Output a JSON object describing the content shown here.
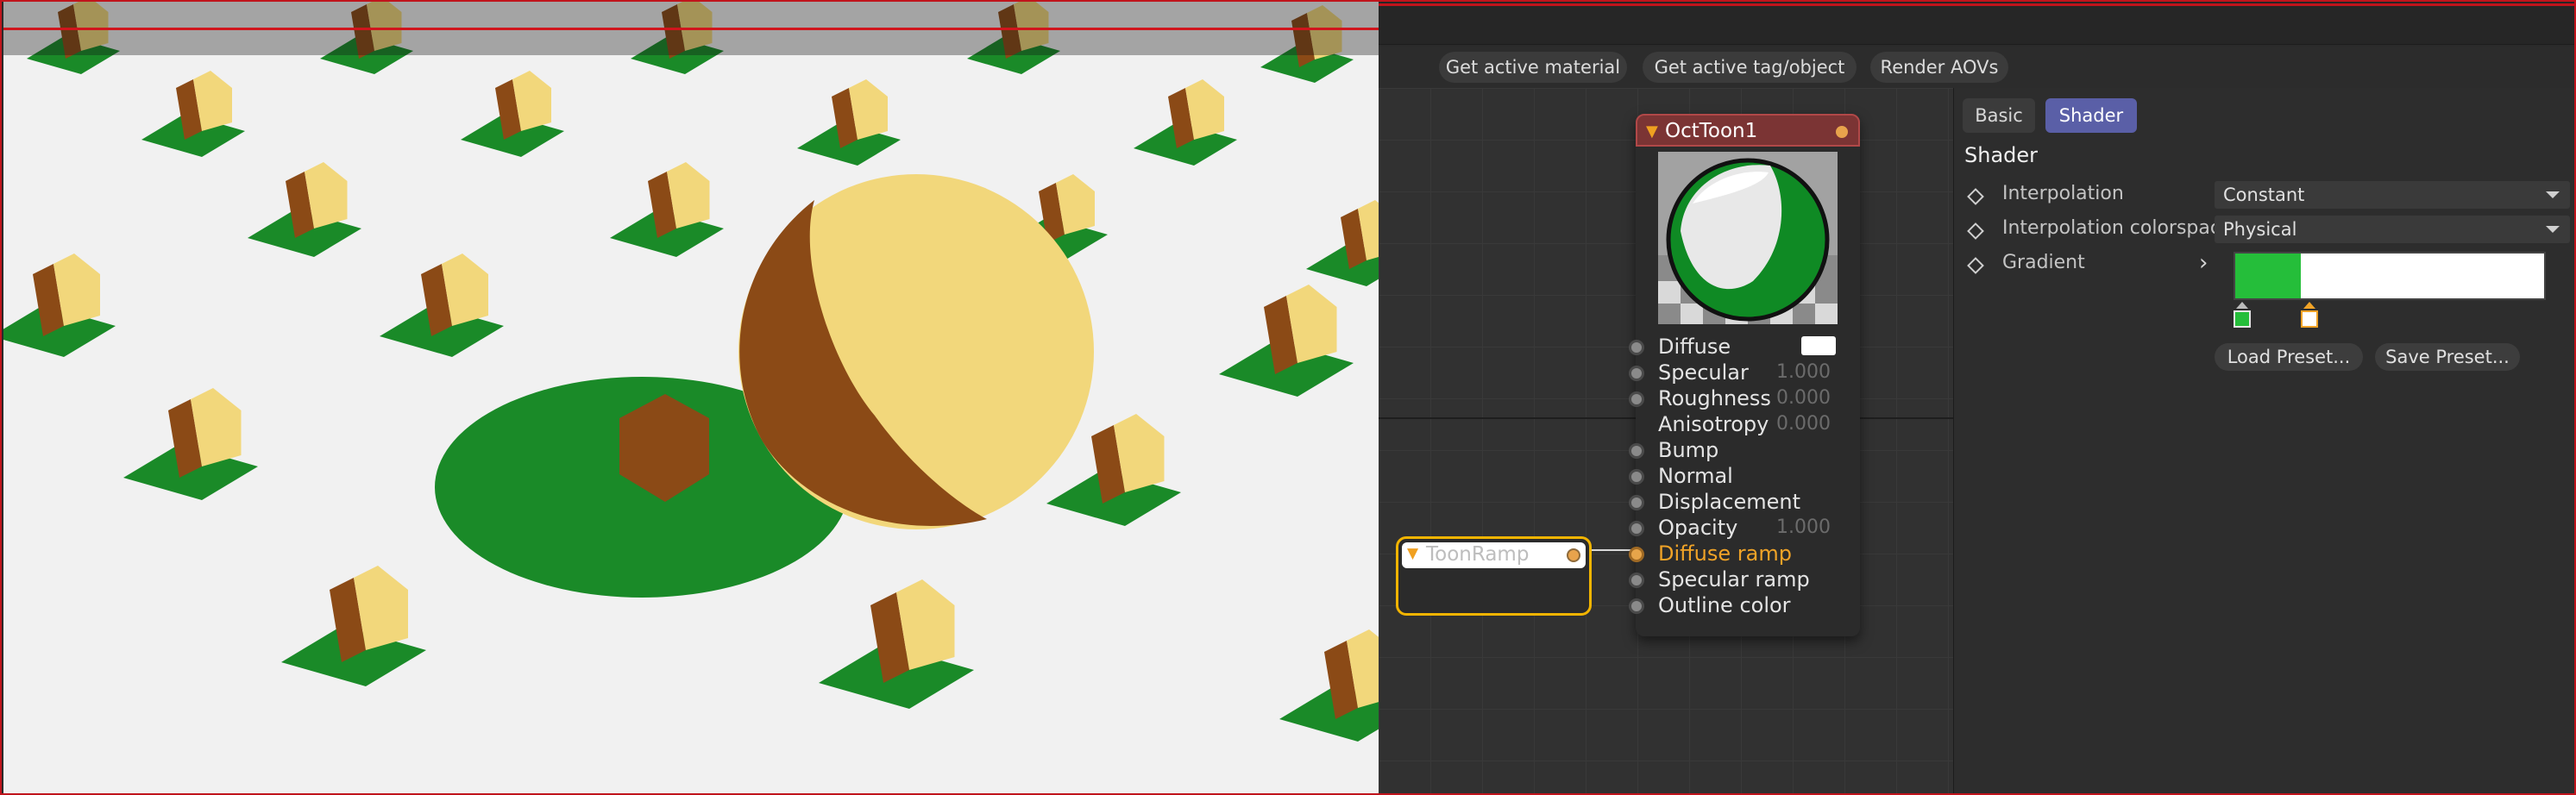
{
  "toolbar": {
    "get_active_material": "Get active material",
    "get_active_tag_object": "Get active tag/object",
    "render_aovs": "Render AOVs"
  },
  "node": {
    "title": "OctToon1",
    "ports": [
      {
        "label": "Diffuse",
        "value": ""
      },
      {
        "label": "Specular",
        "value": "1.000"
      },
      {
        "label": "Roughness",
        "value": "0.000"
      },
      {
        "label": "Anisotropy",
        "value": "0.000"
      },
      {
        "label": "Bump",
        "value": ""
      },
      {
        "label": "Normal",
        "value": ""
      },
      {
        "label": "Displacement",
        "value": ""
      },
      {
        "label": "Opacity",
        "value": "1.000"
      },
      {
        "label": "Diffuse ramp",
        "value": ""
      },
      {
        "label": "Specular ramp",
        "value": ""
      },
      {
        "label": "Outline color",
        "value": ""
      }
    ]
  },
  "toonramp": {
    "title": "ToonRamp"
  },
  "attributes": {
    "tabs": [
      "Basic",
      "Shader"
    ],
    "active_tab": "Shader",
    "section_title": "Shader",
    "interpolation_label": "Interpolation",
    "interpolation_value": "Constant",
    "colorspace_label": "Interpolation colorspace",
    "colorspace_value": "Physical",
    "gradient_label": "Gradient",
    "gradient_knots": [
      {
        "position": 0.0,
        "color": "#25be3a"
      },
      {
        "position": 0.21,
        "color": "#ffffff"
      }
    ],
    "load_preset": "Load Preset...",
    "save_preset": "Save Preset..."
  },
  "colors": {
    "ground": "#f1f1f1",
    "cube_light": "#f2d77b",
    "cube_dark": "#8b4a16",
    "shadow_green": "#1a8a28",
    "accent_orange": "#f0a327",
    "active_tab": "#5a5fa7",
    "node_header": "#7b3434",
    "selection": "#f2b400"
  }
}
